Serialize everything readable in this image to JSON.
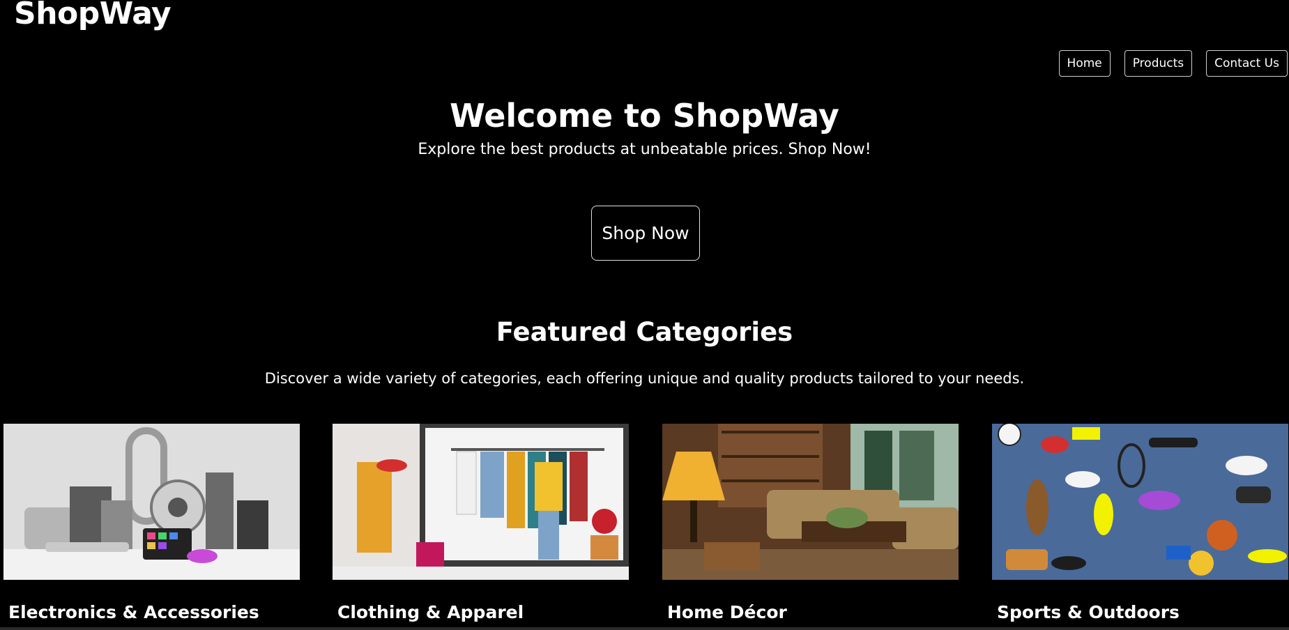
{
  "header": {
    "brand": "ShopWay",
    "nav": [
      {
        "label": "Home"
      },
      {
        "label": "Products"
      },
      {
        "label": "Contact Us"
      }
    ]
  },
  "hero": {
    "title": "Welcome to ShopWay",
    "subtitle": "Explore the best products at unbeatable prices. Shop Now!",
    "cta_label": "Shop Now"
  },
  "featured": {
    "title": "Featured Categories",
    "description": "Discover a wide variety of categories, each offering unique and quality products tailored to your needs.",
    "categories": [
      {
        "label": "Electronics & Accessories"
      },
      {
        "label": "Clothing & Apparel"
      },
      {
        "label": "Home Décor"
      },
      {
        "label": "Sports & Outdoors"
      }
    ]
  },
  "colors": {
    "background": "#000000",
    "text": "#ffffff"
  }
}
